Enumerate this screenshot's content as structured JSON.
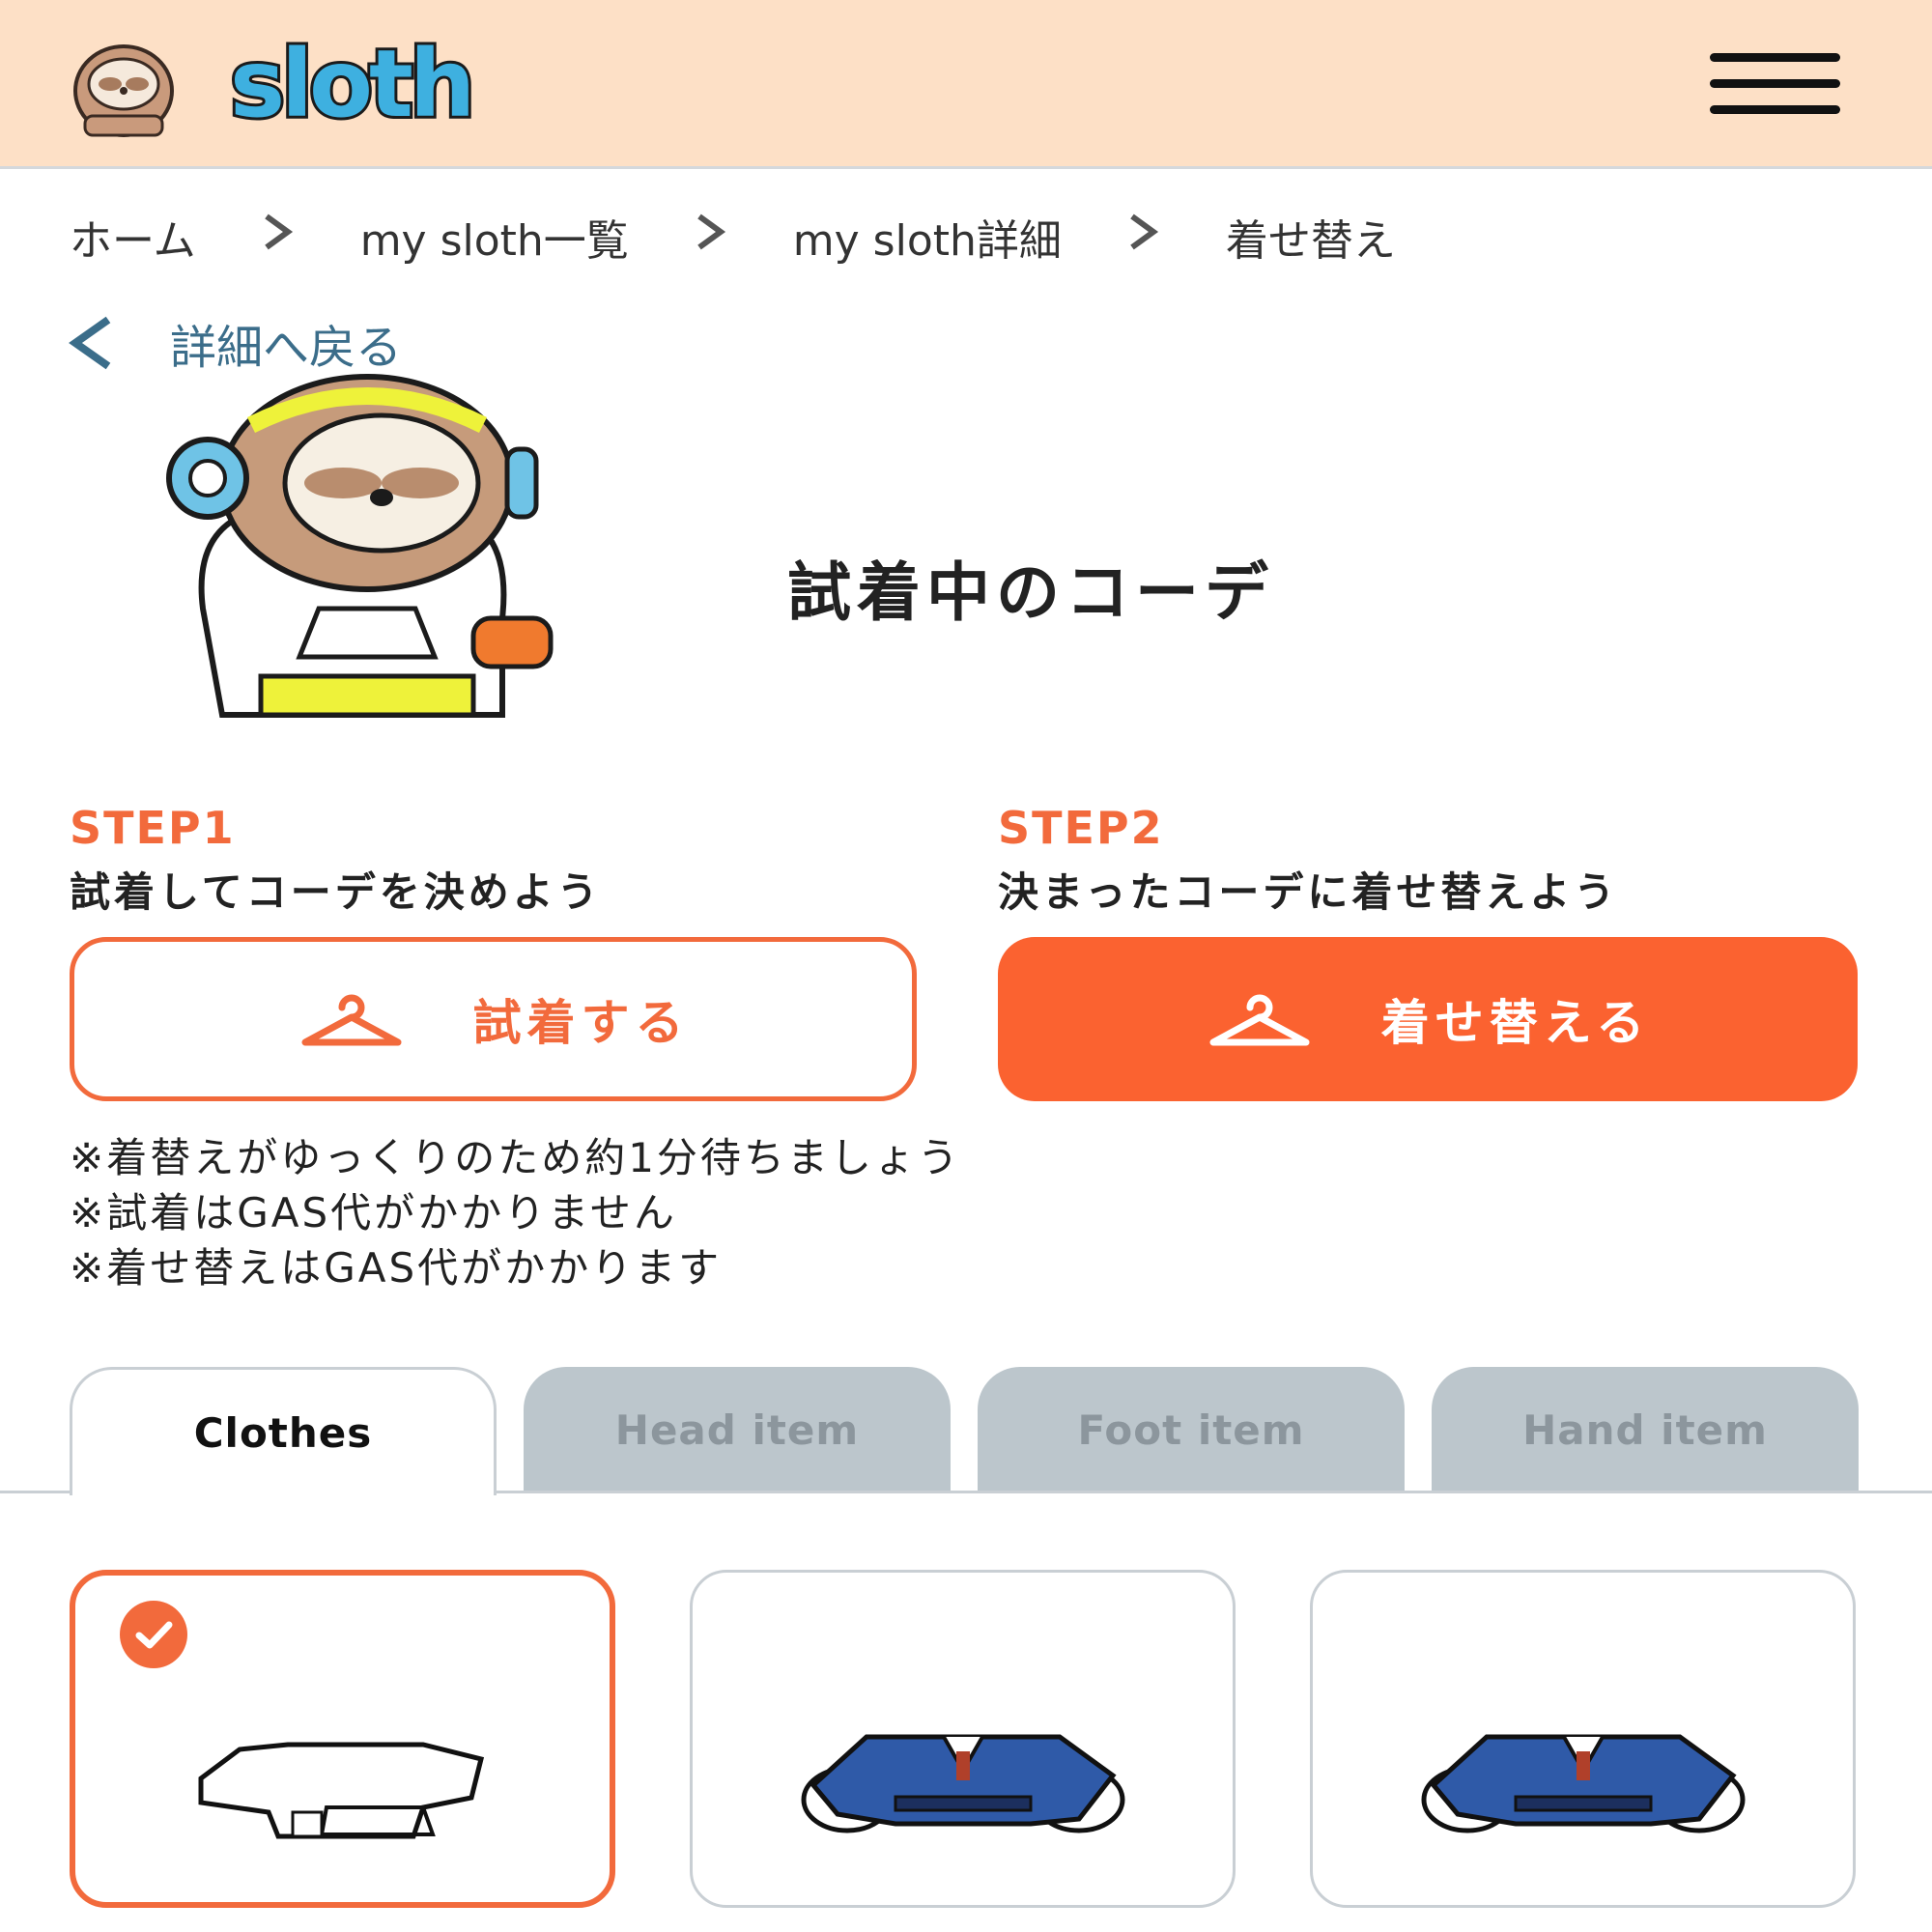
{
  "header": {
    "logo_text": "sloth"
  },
  "breadcrumb": {
    "items": [
      "ホーム",
      "my sloth一覧",
      "my sloth詳細",
      "着せ替え"
    ]
  },
  "back_link": "詳細へ戻る",
  "title": "試着中のコーデ",
  "step1": {
    "label": "STEP1",
    "desc": "試着してコーデを決めよう",
    "button": "試着する"
  },
  "step2": {
    "label": "STEP2",
    "desc": "決まったコーデに着せ替えよう",
    "button": "着せ替える"
  },
  "notes": [
    "※着替えがゆっくりのため約1分待ちましょう",
    "※試着はGAS代がかかりません",
    "※着せ替えはGAS代がかかります"
  ],
  "tabs": [
    {
      "label": "Clothes",
      "active": true
    },
    {
      "label": "Head item",
      "active": false
    },
    {
      "label": "Foot item",
      "active": false
    },
    {
      "label": "Hand item",
      "active": false
    }
  ],
  "items": [
    {
      "name": "white-hoodie",
      "selected": true
    },
    {
      "name": "blue-suit",
      "selected": false
    },
    {
      "name": "blue-suit",
      "selected": false
    }
  ],
  "icons": {
    "menu": "hamburger-icon",
    "crumb_sep": "chevron-right-icon",
    "back": "chevron-left-icon",
    "hanger": "hanger-icon",
    "check": "check-icon"
  },
  "colors": {
    "header_bg": "#fde0c6",
    "accent": "#f26a3c",
    "accent_fill": "#fb6230",
    "link": "#3b6d8a",
    "tab_inactive_bg": "#bcc6cc",
    "tab_inactive_text": "#8c969d"
  }
}
